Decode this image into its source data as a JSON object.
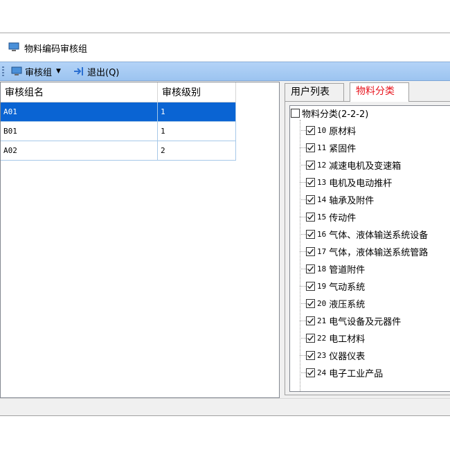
{
  "window": {
    "title": "物料编码审核组"
  },
  "toolbar": {
    "group_label": "审核组",
    "exit_label": "退出(Q)"
  },
  "grid": {
    "columns": [
      "审核组名",
      "审核级别"
    ],
    "rows": [
      {
        "name": "A01",
        "level": "1",
        "selected": true
      },
      {
        "name": "B01",
        "level": "1",
        "selected": false
      },
      {
        "name": "A02",
        "level": "2",
        "selected": false
      }
    ]
  },
  "tabs": [
    {
      "label": "用户列表",
      "active": false
    },
    {
      "label": "物料分类",
      "active": true
    }
  ],
  "tree": {
    "root": {
      "label": "物料分类(2-2-2)",
      "checked": false
    },
    "items": [
      {
        "code": "10",
        "label": "原材料",
        "checked": true
      },
      {
        "code": "11",
        "label": "紧固件",
        "checked": true
      },
      {
        "code": "12",
        "label": "减速电机及变速箱",
        "checked": true
      },
      {
        "code": "13",
        "label": "电机及电动推杆",
        "checked": true
      },
      {
        "code": "14",
        "label": "轴承及附件",
        "checked": true
      },
      {
        "code": "15",
        "label": "传动件",
        "checked": true
      },
      {
        "code": "16",
        "label": "气体、液体输送系统设备",
        "checked": true
      },
      {
        "code": "17",
        "label": "气体，液体输送系统管路",
        "checked": true
      },
      {
        "code": "18",
        "label": "管道附件",
        "checked": true
      },
      {
        "code": "19",
        "label": "气动系统",
        "checked": true
      },
      {
        "code": "20",
        "label": "液压系统",
        "checked": true
      },
      {
        "code": "21",
        "label": "电气设备及元器件",
        "checked": true
      },
      {
        "code": "22",
        "label": "电工材料",
        "checked": true
      },
      {
        "code": "23",
        "label": "仪器仪表",
        "checked": true
      },
      {
        "code": "24",
        "label": "电子工业产品",
        "checked": true
      }
    ]
  },
  "colors": {
    "accent": "#0a64d3",
    "active_tab_text": "#e8141e",
    "toolbar": "#a9cbf3"
  }
}
